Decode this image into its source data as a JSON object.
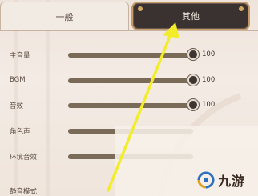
{
  "tabs": {
    "general": "一般",
    "other": "其他"
  },
  "settings": [
    {
      "label": "主音量",
      "value": "100",
      "level": 1.0
    },
    {
      "label": "BGM",
      "value": "100",
      "level": 1.0
    },
    {
      "label": "音效",
      "value": "100",
      "level": 1.0
    },
    {
      "label": "角色声",
      "value": "",
      "level": null
    },
    {
      "label": "环境音效",
      "value": "",
      "level": null
    },
    {
      "label": "静音模式",
      "value": "",
      "level": null
    }
  ],
  "watermark": {
    "text": "九游"
  },
  "colors": {
    "arrow": "#f3ec2a",
    "active_tab": "#3a3230",
    "slider_knob": "#3c3532"
  }
}
